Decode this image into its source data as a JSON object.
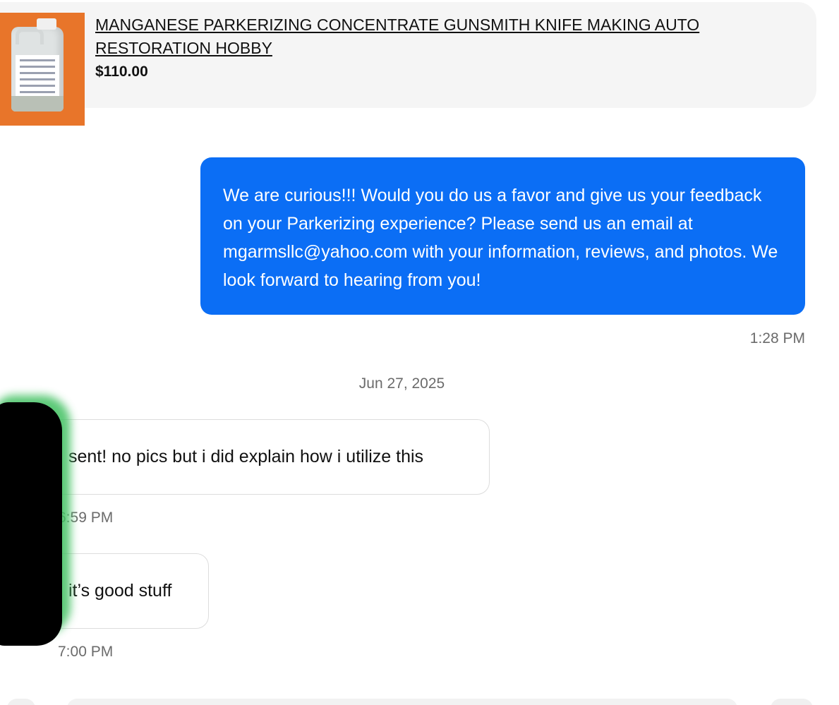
{
  "product": {
    "title": "MANGANESE PARKERIZING CONCENTRATE GUNSMITH KNIFE MAKING AUTO RESTORATION HOBBY",
    "price": "$110.00"
  },
  "messages": [
    {
      "direction": "outgoing",
      "text": "We are curious!!! Would you do us a favor and give us your feedback on your Parkerizing experience? Please send us an email at mgarmsllc@yahoo.com with your information, reviews, and photos. We look forward to hearing from you!",
      "time": "1:28 PM"
    },
    {
      "direction": "incoming",
      "text": "sent! no pics but i did explain how i utilize this",
      "time": "6:59 PM"
    },
    {
      "direction": "incoming",
      "text": "it’s good stuff",
      "time": "7:00 PM"
    }
  ],
  "date_separator": "Jun 27, 2025",
  "colors": {
    "outgoing_bubble": "#0b6ef5",
    "card_background": "#f5f5f5",
    "timestamp": "#6b6b6b"
  }
}
